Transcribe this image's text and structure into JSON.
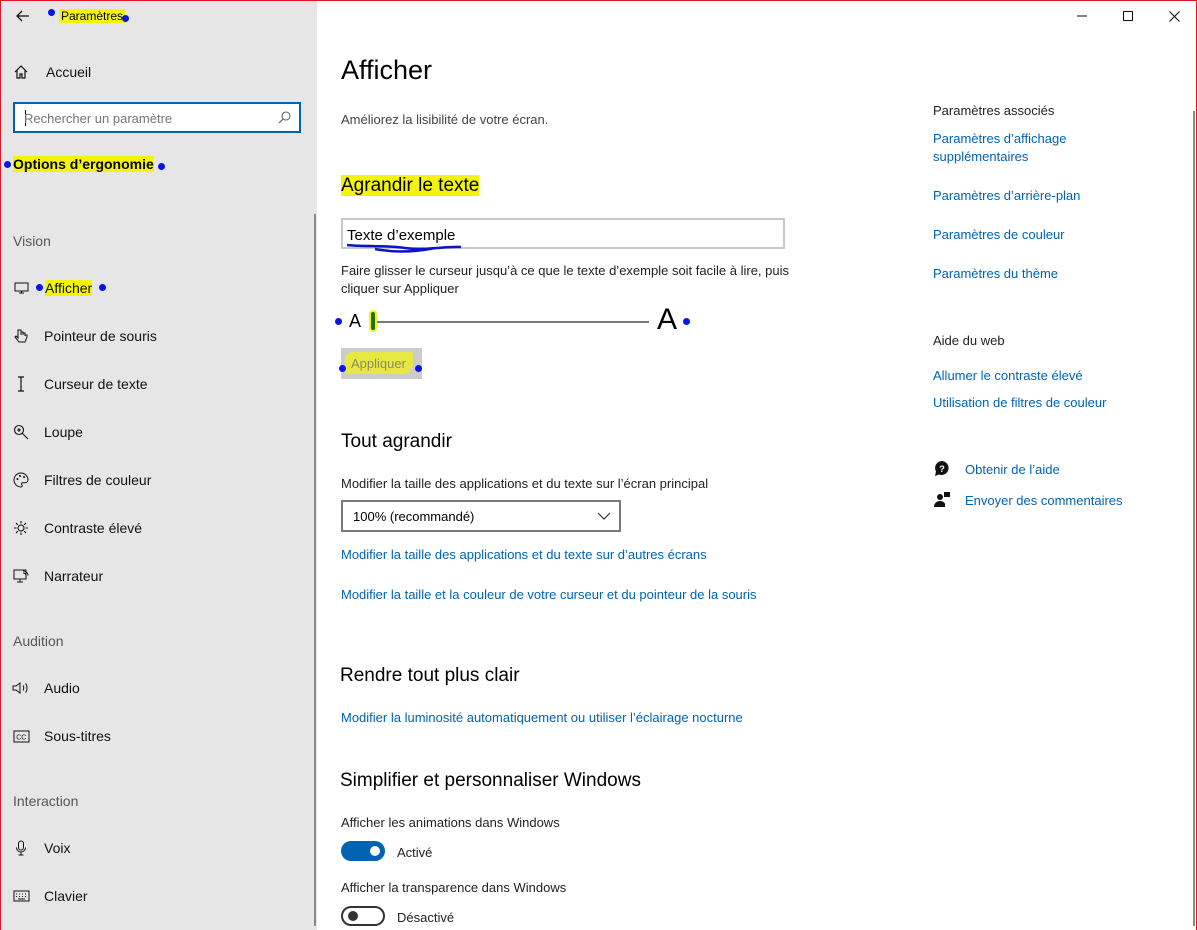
{
  "window": {
    "title": "Paramètres"
  },
  "sidebar": {
    "home_label": "Accueil",
    "search_placeholder": "Rechercher un paramètre",
    "section_title": "Options d’ergonomie",
    "groups": {
      "vision": "Vision",
      "audition": "Audition",
      "interaction": "Interaction"
    },
    "items": {
      "afficher": "Afficher",
      "pointeur": "Pointeur de souris",
      "curseur": "Curseur de texte",
      "loupe": "Loupe",
      "filtres": "Filtres de couleur",
      "contraste": "Contraste élevé",
      "narrateur": "Narrateur",
      "audio": "Audio",
      "soustitres": "Sous-titres",
      "voix": "Voix",
      "clavier": "Clavier"
    }
  },
  "main": {
    "title": "Afficher",
    "subtitle": "Améliorez la lisibilité de votre écran.",
    "agrandir_texte": {
      "heading": "Agrandir le texte",
      "sample": "Texte d’exemple",
      "instructions": "Faire glisser le curseur jusqu’à ce que le texte d’exemple soit facile à lire, puis cliquer sur Appliquer",
      "small_a": "A",
      "big_a": "A",
      "apply_label": "Appliquer",
      "slider_level": 0.0
    },
    "tout_agrandir": {
      "heading": "Tout agrandir",
      "label": "Modifier la taille des applications et du texte sur l’écran principal",
      "dropdown_value": "100% (recommandé)",
      "link1": "Modifier la taille des applications et du texte sur d’autres écrans",
      "link2": "Modifier la taille et la couleur de votre curseur et du pointeur de la souris"
    },
    "rendre_clair": {
      "heading": "Rendre tout plus clair",
      "link": "Modifier la luminosité automatiquement ou utiliser l’éclairage nocturne"
    },
    "simplifier": {
      "heading": "Simplifier et personnaliser Windows",
      "animations_label": "Afficher les animations dans Windows",
      "animations_state": "Activé",
      "transparence_label": "Afficher la transparence dans Windows",
      "transparence_state": "Désactivé"
    }
  },
  "right": {
    "associated_title": "Paramètres associés",
    "associated_links": [
      "Paramètres d’affichage supplémentaires",
      "Paramètres d’arrière-plan",
      "Paramètres de couleur",
      "Paramètres du thème"
    ],
    "web_title": "Aide du web",
    "web_links": [
      "Allumer le contraste élevé",
      "Utilisation de filtres de couleur"
    ],
    "help_label": "Obtenir de l’aide",
    "feedback_label": "Envoyer des commentaires"
  },
  "colors": {
    "accent": "#0063b1",
    "highlight": "#f4f40a",
    "annotation_dot": "#0a14e6",
    "sidebar_bg": "#e6e6e6"
  }
}
